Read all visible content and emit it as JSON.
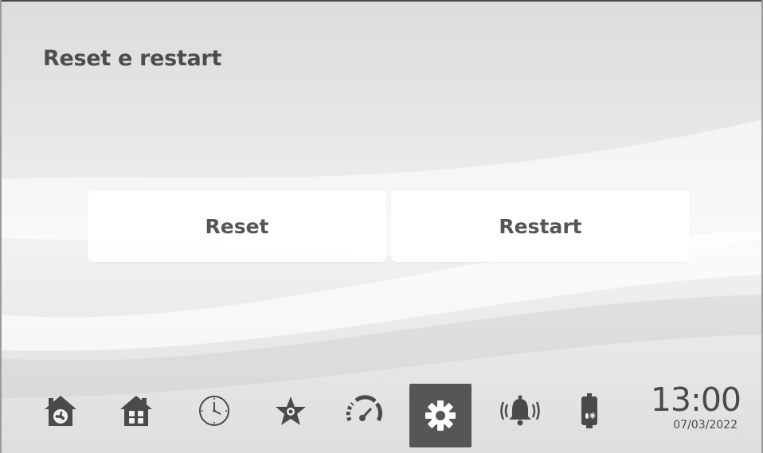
{
  "screen": {
    "title": "Reset e restart"
  },
  "actions": {
    "reset_label": "Reset",
    "restart_label": "Restart"
  },
  "bottom_nav": {
    "items": [
      {
        "name": "zone-1-home",
        "icon": "house-fan-icon"
      },
      {
        "name": "zone-2-home",
        "icon": "house-windows-icon"
      },
      {
        "name": "schedule",
        "icon": "clock-icon"
      },
      {
        "name": "favorites",
        "icon": "star-icon"
      },
      {
        "name": "performance",
        "icon": "gauge-icon"
      },
      {
        "name": "settings",
        "icon": "gear-icon",
        "active": true
      },
      {
        "name": "alarms",
        "icon": "bell-icon"
      },
      {
        "name": "water-heater",
        "icon": "boiler-icon"
      }
    ]
  },
  "status": {
    "time": "13:00",
    "date": "07/03/2022"
  },
  "colors": {
    "text": "#4d4d4d",
    "active_tab_bg": "#565656",
    "button_bg": "#ffffff"
  }
}
